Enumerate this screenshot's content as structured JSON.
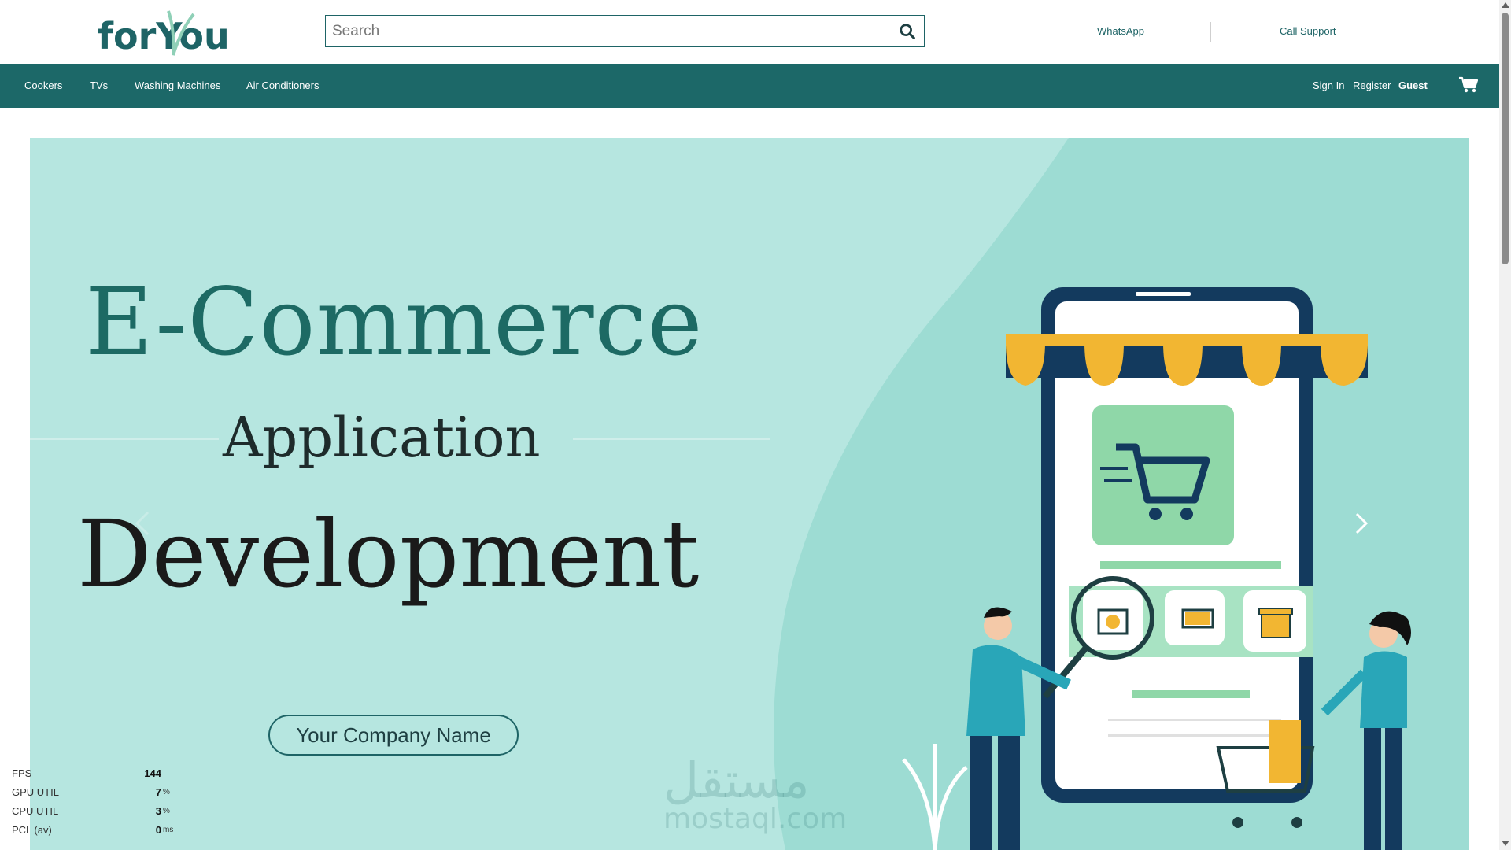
{
  "header": {
    "logo_text": "forYou",
    "search_placeholder": "Search",
    "links": [
      "WhatsApp",
      "Call Support"
    ]
  },
  "nav": {
    "categories": [
      "Cookers",
      "TVs",
      "Washing Machines",
      "Air Conditioners"
    ],
    "sign_in": "Sign In",
    "register": "Register",
    "user": "Guest"
  },
  "hero": {
    "line1": "E-Commerce",
    "line2": "Application",
    "line3": "Development",
    "company_button": "Your Company Name",
    "watermark_ar": "مستقل",
    "watermark_en": "mostaql.com"
  },
  "perf": [
    {
      "label": "FPS",
      "value": "144",
      "unit": ""
    },
    {
      "label": "GPU UTIL",
      "value": "7",
      "unit": "%"
    },
    {
      "label": "CPU UTIL",
      "value": "3",
      "unit": "%"
    },
    {
      "label": "PCL (av)",
      "value": "0",
      "unit": "ms"
    }
  ],
  "colors": {
    "brand": "#1c6868",
    "hero_bg": "#b6e6e0",
    "accent_yellow": "#f2b632",
    "navy": "#133a5e"
  },
  "icons": {
    "search": "search-icon",
    "cart": "cart-icon",
    "prev": "chevron-left-icon",
    "next": "chevron-right-icon"
  }
}
